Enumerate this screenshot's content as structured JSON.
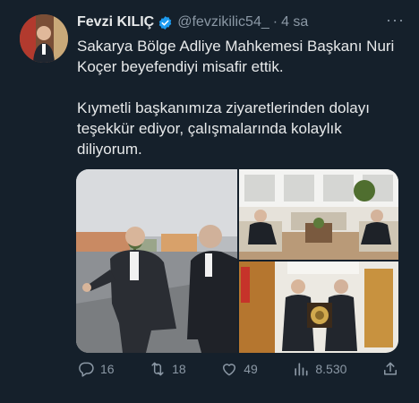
{
  "tweet": {
    "author_name": "Fevzi KILIÇ",
    "handle": "@fevzikilic54_",
    "separator": "·",
    "time": "4 sa",
    "more": "···",
    "paragraph1": "Sakarya Bölge Adliye Mahkemesi Başkanı Nuri Koçer beyefendiyi misafir ettik.",
    "paragraph2": "Kıymetli başkanımıza ziyaretlerinden dolayı teşekkür ediyor, çalışmalarında kolaylık diliyorum."
  },
  "actions": {
    "replies": "16",
    "retweets": "18",
    "likes": "49",
    "views": "8.530"
  },
  "colors": {
    "background": "#15202b",
    "text": "#e7e9ea",
    "muted": "#8b98a5",
    "verified": "#1d9bf0"
  },
  "icons": [
    "verified-badge-icon",
    "more-icon",
    "reply-icon",
    "retweet-icon",
    "like-icon",
    "views-icon",
    "share-icon"
  ]
}
